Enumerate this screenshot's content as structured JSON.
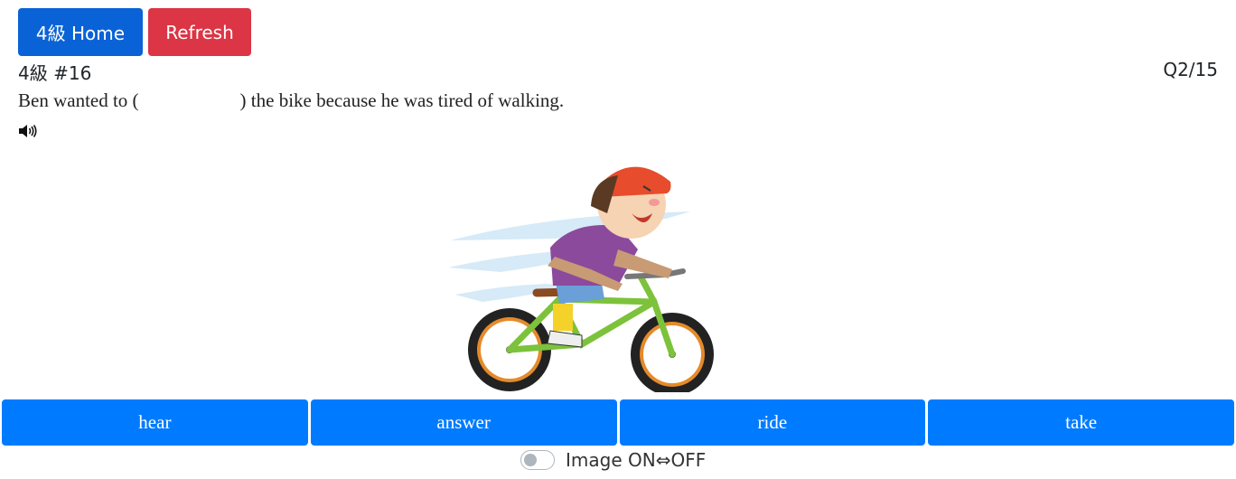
{
  "header": {
    "home_label": "4級 Home",
    "refresh_label": "Refresh"
  },
  "quiz": {
    "set_label": "4級 #16",
    "progress": "Q2/15",
    "question_before": "Ben wanted to (",
    "question_after": ") the bike because he was tired of walking."
  },
  "choices": [
    "hear",
    "answer",
    "ride",
    "take"
  ],
  "image_toggle": {
    "label": "Image ON⇔OFF",
    "state": "off"
  },
  "icons": {
    "speaker": "speaker-icon",
    "illustration": "boy-riding-bike-illustration"
  },
  "colors": {
    "primary": "#007bff",
    "home": "#0a63d6",
    "danger": "#dc3545"
  }
}
